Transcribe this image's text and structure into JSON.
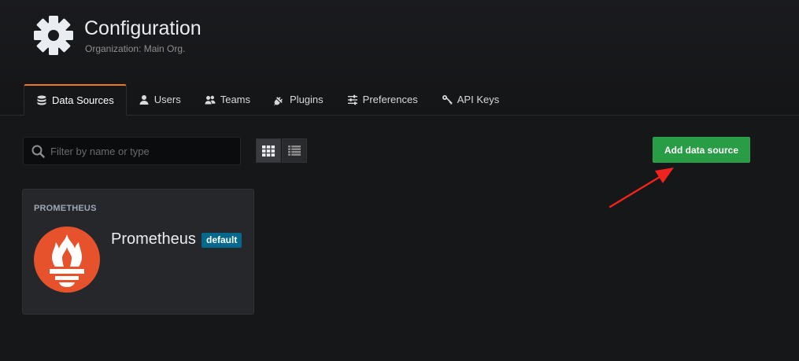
{
  "header": {
    "title": "Configuration",
    "subtitle": "Organization: Main Org."
  },
  "tabs": [
    {
      "label": "Data Sources",
      "icon": "database-icon",
      "active": true
    },
    {
      "label": "Users",
      "icon": "user-icon",
      "active": false
    },
    {
      "label": "Teams",
      "icon": "users-icon",
      "active": false
    },
    {
      "label": "Plugins",
      "icon": "plug-icon",
      "active": false
    },
    {
      "label": "Preferences",
      "icon": "sliders-icon",
      "active": false
    },
    {
      "label": "API Keys",
      "icon": "key-icon",
      "active": false
    }
  ],
  "search": {
    "placeholder": "Filter by name or type",
    "value": ""
  },
  "view_toggle": {
    "active": "grid"
  },
  "actions": {
    "add_label": "Add data source"
  },
  "datasources": [
    {
      "type_label": "PROMETHEUS",
      "name": "Prometheus",
      "badge": "default",
      "logo": "prometheus-logo"
    }
  ],
  "colors": {
    "accent_orange": "#eb7b18",
    "primary_green": "#299c46",
    "badge_blue": "#05688e",
    "prometheus_red": "#e6522c",
    "annotation_red": "#f0231e"
  }
}
